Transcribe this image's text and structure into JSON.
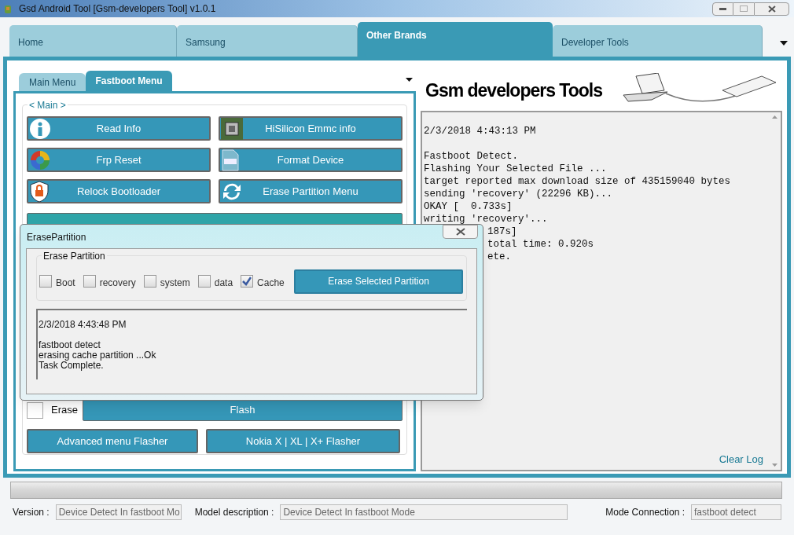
{
  "window": {
    "title": "Gsd Android Tool [Gsm-developers Tool] v1.0.1"
  },
  "tabs": [
    {
      "label": "Home",
      "selected": false
    },
    {
      "label": "Samsung",
      "selected": false
    },
    {
      "label": "Other Brands",
      "selected": true
    },
    {
      "label": "Developer Tools",
      "selected": false
    }
  ],
  "sub_tabs": [
    {
      "label": "Main Menu",
      "selected": false
    },
    {
      "label": "Fastboot Menu",
      "selected": true
    }
  ],
  "group_title": "< Main >",
  "buttons": [
    {
      "label": "Read Info"
    },
    {
      "label": "HiSilicon Emmc info"
    },
    {
      "label": "Frp Reset"
    },
    {
      "label": "Format Device"
    },
    {
      "label": "Relock Bootloader"
    },
    {
      "label": "Erase Partition Menu"
    }
  ],
  "erase": {
    "label": "Erase",
    "checked": false
  },
  "flash_button": "Flash",
  "bottom_buttons": [
    {
      "label": "Advanced menu Flasher"
    },
    {
      "label": "Nokia X | XL | X+ Flasher"
    }
  ],
  "banner_title": "Gsm developers Tools",
  "log_blocks": [
    [
      {
        "text": "2/3/2018 4:43:13 PM",
        "kind": "full"
      }
    ],
    [
      {
        "text": "Fastboot Detect.",
        "kind": "full"
      },
      {
        "text": "Flashing Your Selected File ...",
        "kind": "full"
      },
      {
        "text": "target reported max download size of 435159040 bytes",
        "kind": "full"
      },
      {
        "text": "sending 'recovery' (22296 KB)...",
        "kind": "full"
      },
      {
        "text": "OKAY [  0.733s]",
        "kind": "full"
      },
      {
        "text": "writing 'recovery'...",
        "kind": "full"
      },
      {
        "text": "187s]",
        "kind": "partial"
      },
      {
        "text": "total time: 0.920s",
        "kind": "partial"
      },
      {
        "text": "ete.",
        "kind": "partial"
      }
    ]
  ],
  "clear_log": "Clear Log",
  "progress": {
    "level": 0
  },
  "status": [
    {
      "label": "Version :",
      "value": "Device Detect In fastboot Mo"
    },
    {
      "label": "Model description :",
      "value": "Device Detect In fastboot Mode"
    },
    {
      "label": "Mode Connection :",
      "value": "fastboot detect"
    }
  ],
  "dialog": {
    "title": "ErasePartition",
    "group_title": "Erase Partition",
    "partitions": [
      {
        "label": "Boot",
        "checked": false
      },
      {
        "label": "recovery",
        "checked": false
      },
      {
        "label": "system",
        "checked": false
      },
      {
        "label": "data",
        "checked": false
      },
      {
        "label": "Cache",
        "checked": true
      }
    ],
    "button": "Erase Selected Partition",
    "log_blocks": [
      [
        "2/3/2018 4:43:48 PM"
      ],
      [
        "fastboot detect",
        "erasing cache partition ...Ok",
        "Task Complete."
      ]
    ]
  }
}
